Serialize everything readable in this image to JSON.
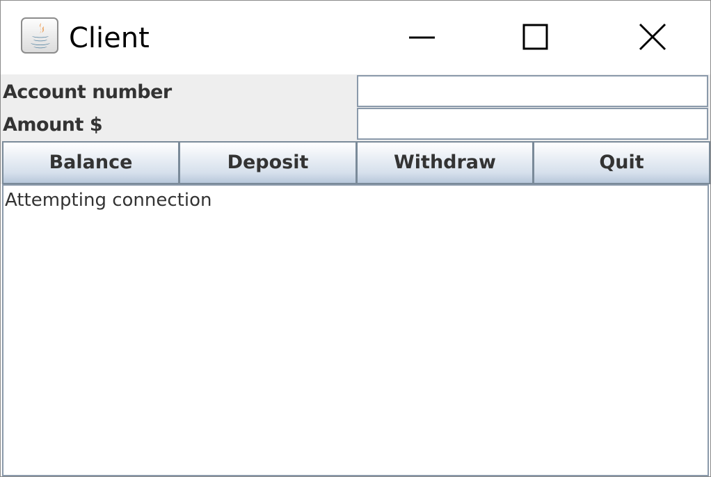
{
  "window": {
    "title": "Client",
    "icon": "java-cup-icon",
    "controls": {
      "minimize_icon": "minimize-icon",
      "maximize_icon": "maximize-icon",
      "close_icon": "close-icon"
    }
  },
  "form": {
    "account_label": "Account number",
    "account_value": "",
    "amount_label": "Amount $",
    "amount_value": ""
  },
  "buttons": {
    "balance": "Balance",
    "deposit": "Deposit",
    "withdraw": "Withdraw",
    "quit": "Quit"
  },
  "output": {
    "text": "Attempting connection"
  },
  "colors": {
    "panel_bg": "#eeeeee",
    "border": "#8a99aa",
    "text": "#333333",
    "java_orange": "#e76f00",
    "java_blue": "#5382a1"
  }
}
